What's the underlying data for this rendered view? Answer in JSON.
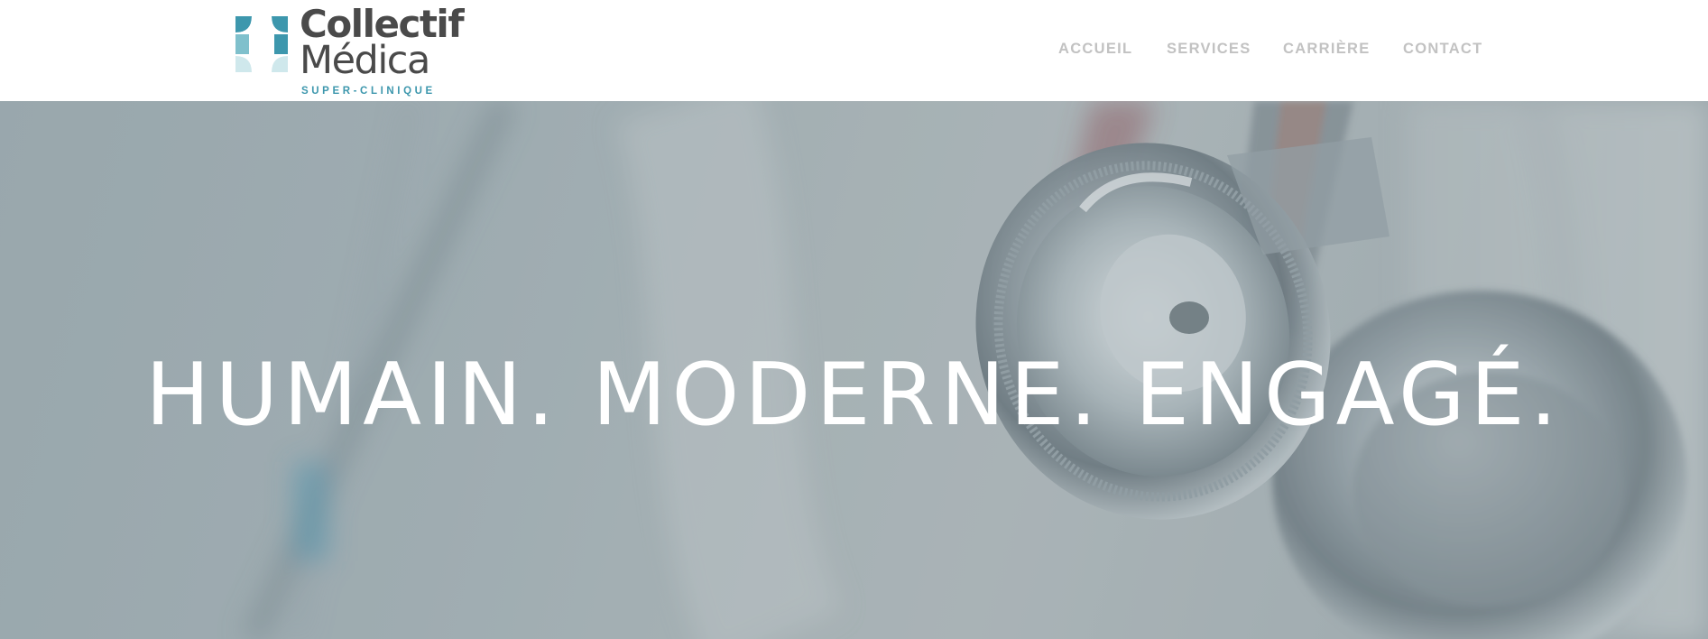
{
  "brand": {
    "name_line1": "Collectif",
    "name_line2": "Médica",
    "tagline": "SUPER-CLINIQUE",
    "colors": {
      "text": "#4a4a4a",
      "teal": "#3d97ad",
      "light_teal": "#cfe8ec"
    },
    "icon": "cross-logo-icon"
  },
  "nav": {
    "items": [
      {
        "label": "ACCUEIL"
      },
      {
        "label": "SERVICES"
      },
      {
        "label": "CARRIÈRE"
      },
      {
        "label": "CONTACT"
      }
    ],
    "color": "#c2c2c2"
  },
  "hero": {
    "title": "HUMAIN. MODERNE. ENGAGÉ.",
    "image": "stethoscope-on-white-coat",
    "overlay_color": "#9eabb0"
  }
}
